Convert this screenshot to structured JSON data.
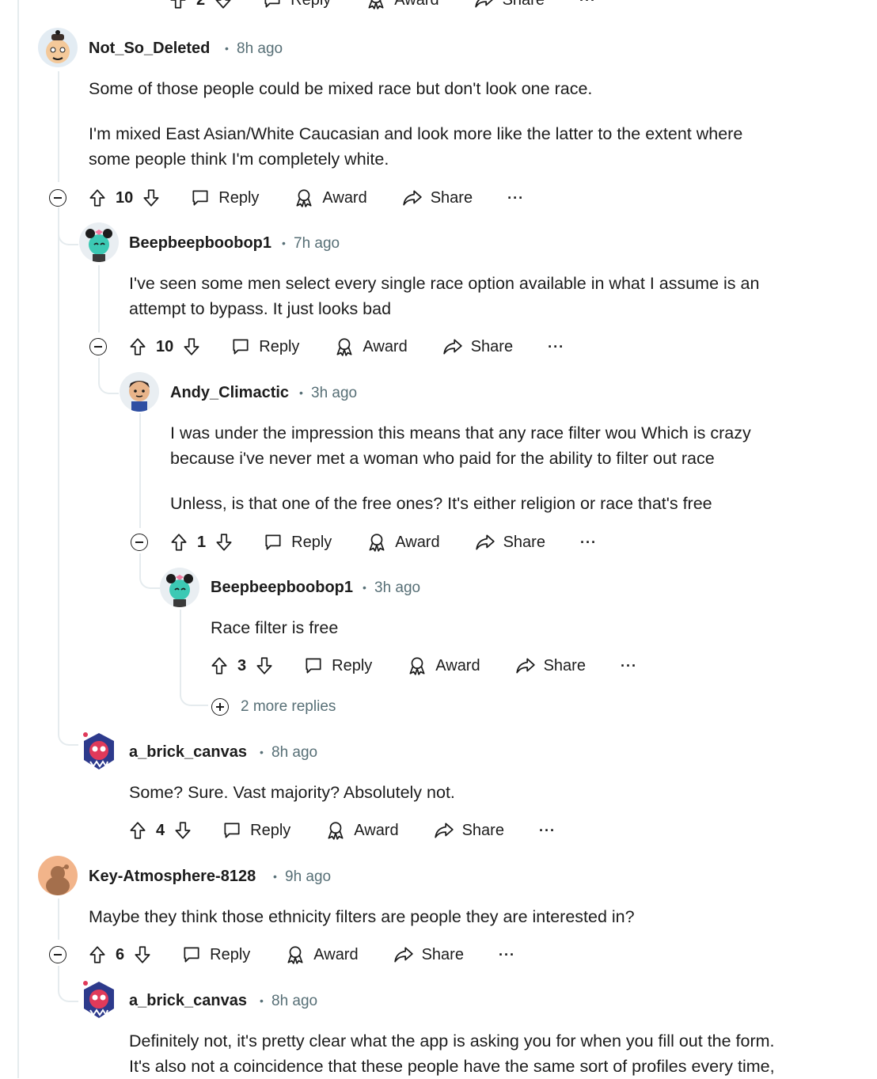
{
  "actions": {
    "reply": "Reply",
    "award": "Award",
    "share": "Share",
    "more": "···"
  },
  "top_partial": {
    "votes": "2"
  },
  "comments": [
    {
      "user": "Not_So_Deleted",
      "time": "8h ago",
      "lines": [
        "Some of those people could be mixed race but don't look one race.",
        "",
        "I'm mixed East Asian/White Caucasian and look more like the latter to the extent where",
        "some people think I'm completely white."
      ],
      "votes": "10"
    },
    {
      "user": "Beepbeepboobop1",
      "time": "7h ago",
      "lines": [
        "I've seen some men select every single race option available in what I assume is an",
        "attempt to bypass. It just looks bad"
      ],
      "votes": "10"
    },
    {
      "user": "Andy_Climactic",
      "time": "3h ago",
      "lines": [
        "I was under the impression this means that any race filter wou Which is crazy",
        "because i've never met a woman who paid for the ability to filter out race",
        "",
        "Unless, is that one of the free ones? It's either religion or race that's free"
      ],
      "votes": "1"
    },
    {
      "user": "Beepbeepboobop1",
      "time": "3h ago",
      "lines": [
        "Race filter is free"
      ],
      "votes": "3"
    },
    {
      "user": "a_brick_canvas",
      "time": "8h ago",
      "lines": [
        "Some? Sure. Vast majority? Absolutely not."
      ],
      "votes": "4"
    },
    {
      "user": "Key-Atmosphere-8128",
      "time": "9h ago",
      "lines": [
        "Maybe they think those ethnicity filters are people they are interested in?"
      ],
      "votes": "6"
    },
    {
      "user": "a_brick_canvas",
      "time": "8h ago",
      "lines": [
        "Definitely not, it's pretty clear what the app is asking you for when you fill out the form.",
        "It's also not a coincidence that these people have the same sort of profiles every time,"
      ]
    }
  ],
  "more_replies": "2 more replies",
  "colors": {
    "text": "#1c1c1c",
    "meta": "#576f76",
    "thread": "#e5ebee"
  }
}
